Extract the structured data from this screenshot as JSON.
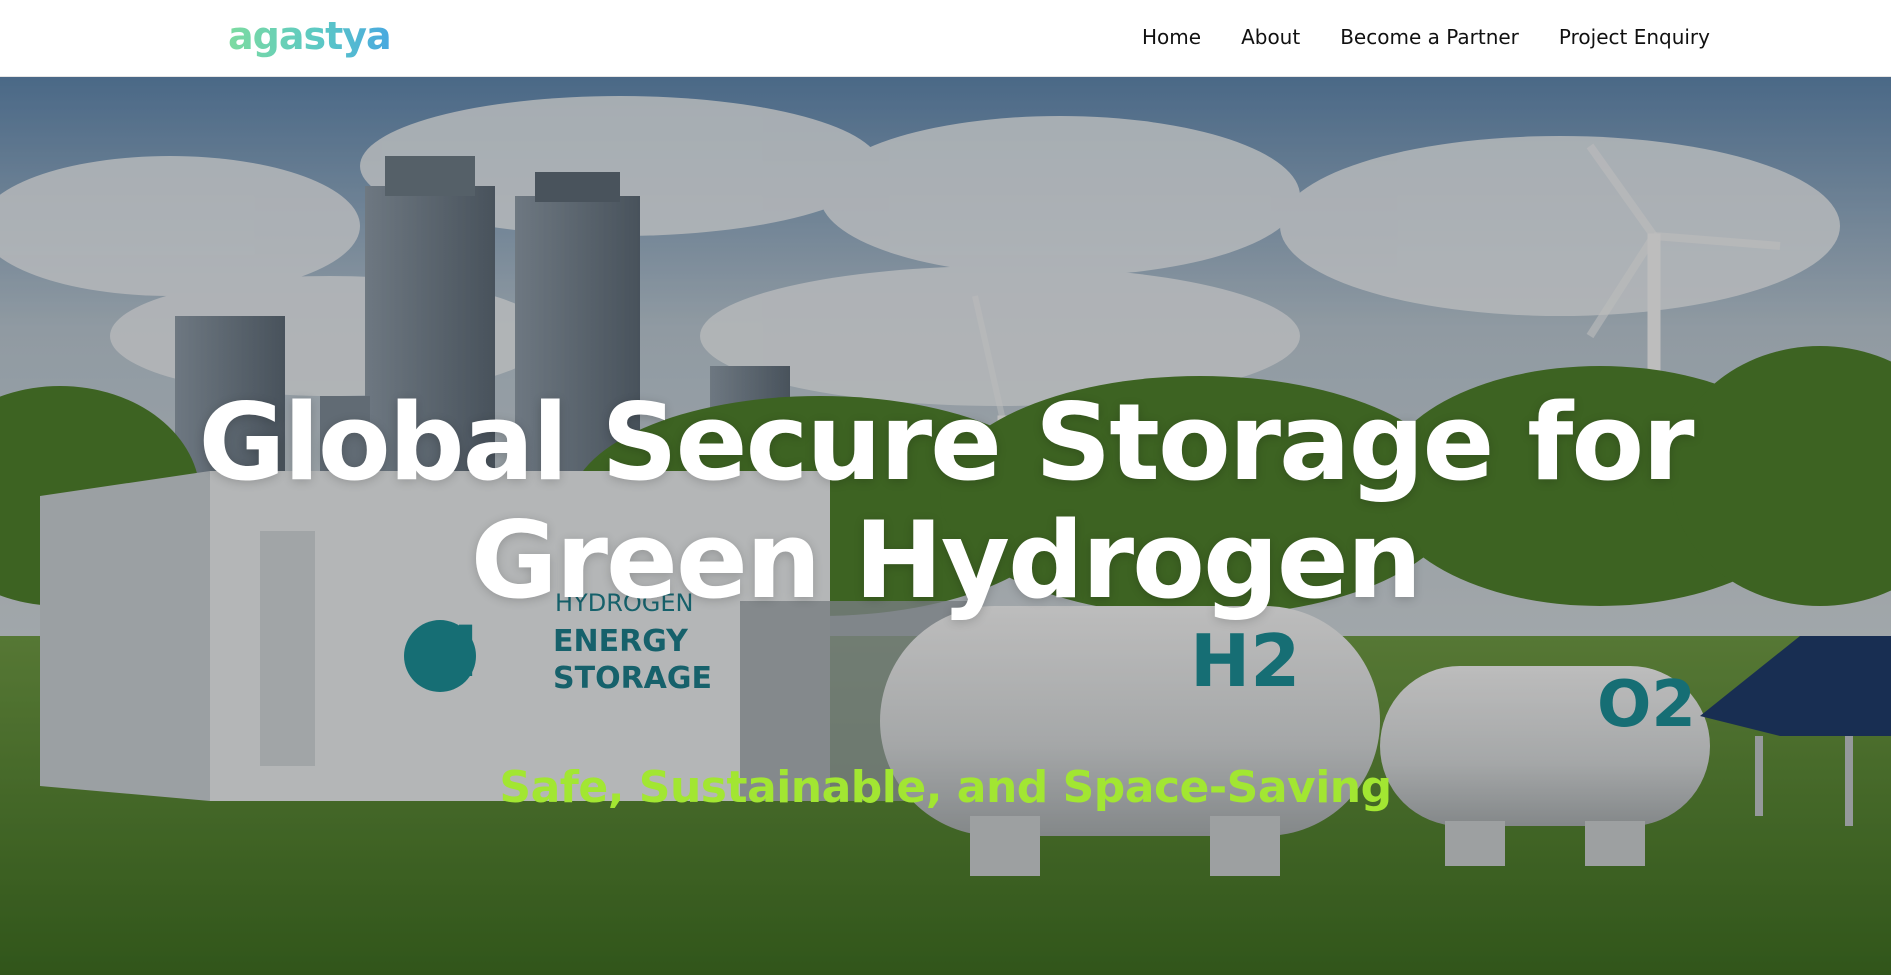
{
  "header": {
    "logo_text": "agastya",
    "nav": [
      {
        "label": "Home"
      },
      {
        "label": "About"
      },
      {
        "label": "Become a Partner"
      },
      {
        "label": "Project Enquiry"
      }
    ]
  },
  "hero": {
    "title_line1": "Global Secure Storage for",
    "title_line2": "Green Hydrogen",
    "subtitle": "Safe, Sustainable, and Space-Saving",
    "background": {
      "scene": "city skyline, wind turbines, hydrogen storage container and tanks, solar panels on grass",
      "container_labels": {
        "brand": "HYDROGEN",
        "line2": "ENERGY",
        "line3": "STORAGE",
        "symbol": "H2"
      },
      "tank_labels": [
        "H2",
        "O2"
      ]
    }
  },
  "colors": {
    "logo_gradient_start": "#7ddba0",
    "logo_gradient_end": "#49a8e0",
    "nav_text": "#111111",
    "hero_title": "#ffffff",
    "hero_subtitle": "#a2e632"
  }
}
